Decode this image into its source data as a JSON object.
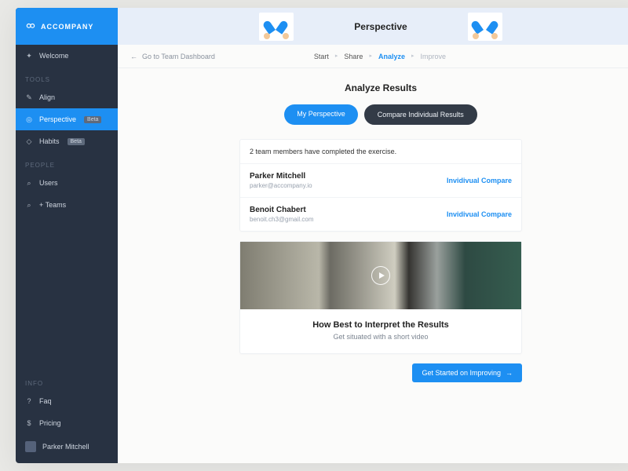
{
  "brand": {
    "name": "ACCOMPANY"
  },
  "sidebar": {
    "welcome": "Welcome",
    "sections": {
      "tools": "TOOLS",
      "people": "PEOPLE",
      "info": "INFO"
    },
    "items": {
      "align": "Align",
      "perspective": "Perspective",
      "perspective_badge": "Beta",
      "habits": "Habits",
      "habits_badge": "Beta",
      "users": "Users",
      "teams": "+ Teams",
      "faq": "Faq",
      "pricing": "Pricing"
    },
    "user": {
      "name": "Parker Mitchell"
    }
  },
  "header": {
    "title": "Perspective",
    "back_label": "Go to Team Dashboard"
  },
  "steps": {
    "start": "Start",
    "share": "Share",
    "analyze": "Analyze",
    "improve": "Improve"
  },
  "analyze": {
    "title": "Analyze Results",
    "tabs": {
      "mine": "My Perspective",
      "compare": "Compare Individual Results"
    },
    "completion_note": "2 team members have completed the exercise.",
    "members": [
      {
        "name": "Parker Mitchell",
        "email": "parker@accompany.io",
        "action": "Invidivual Compare"
      },
      {
        "name": "Benoit Chabert",
        "email": "benoit.ch3@gmail.com",
        "action": "Invidivual Compare"
      }
    ],
    "video": {
      "title": "How Best to Interpret the Results",
      "subtitle": "Get situated with a short video"
    },
    "cta": "Get Started on Improving"
  }
}
